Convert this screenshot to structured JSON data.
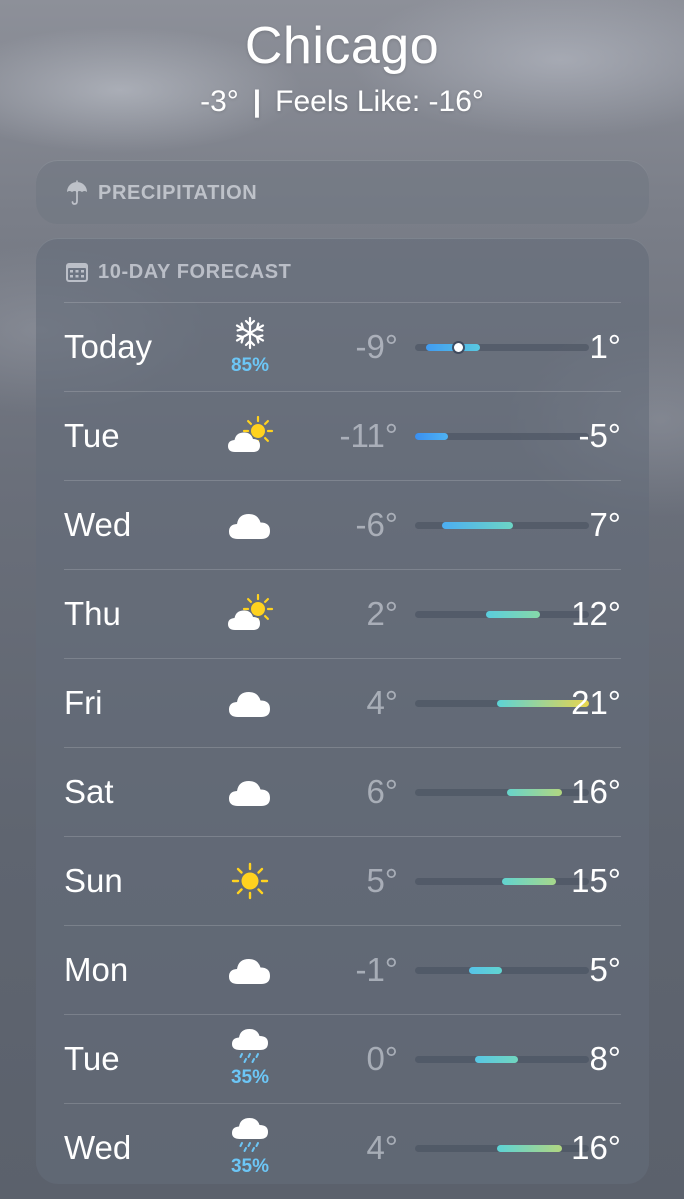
{
  "location": {
    "city": "Chicago",
    "current_temp": "-3°",
    "separator": "|",
    "feels_like": "Feels Like: -16°"
  },
  "precipitation": {
    "title": "PRECIPITATION",
    "icon": "umbrella-icon"
  },
  "forecast": {
    "title": "10-DAY FORECAST",
    "icon": "calendar-icon",
    "range_scale": {
      "min": -11,
      "max": 21
    },
    "current_temp_value": -3,
    "days": [
      {
        "day": "Today",
        "condition": "snow",
        "icon": "snowflake-icon",
        "chance": "85%",
        "low": "-9°",
        "high": "1°",
        "low_value": -9,
        "high_value": 1
      },
      {
        "day": "Tue",
        "condition": "partly-cloudy",
        "icon": "partly-sunny-icon",
        "chance": "",
        "low": "-11°",
        "high": "-5°",
        "low_value": -11,
        "high_value": -5
      },
      {
        "day": "Wed",
        "condition": "cloudy",
        "icon": "cloud-icon",
        "chance": "",
        "low": "-6°",
        "high": "7°",
        "low_value": -6,
        "high_value": 7
      },
      {
        "day": "Thu",
        "condition": "partly-cloudy",
        "icon": "partly-sunny-icon",
        "chance": "",
        "low": "2°",
        "high": "12°",
        "low_value": 2,
        "high_value": 12
      },
      {
        "day": "Fri",
        "condition": "cloudy",
        "icon": "cloud-icon",
        "chance": "",
        "low": "4°",
        "high": "21°",
        "low_value": 4,
        "high_value": 21
      },
      {
        "day": "Sat",
        "condition": "cloudy",
        "icon": "cloud-icon",
        "chance": "",
        "low": "6°",
        "high": "16°",
        "low_value": 6,
        "high_value": 16
      },
      {
        "day": "Sun",
        "condition": "sunny",
        "icon": "sun-icon",
        "chance": "",
        "low": "5°",
        "high": "15°",
        "low_value": 5,
        "high_value": 15
      },
      {
        "day": "Mon",
        "condition": "cloudy",
        "icon": "cloud-icon",
        "chance": "",
        "low": "-1°",
        "high": "5°",
        "low_value": -1,
        "high_value": 5
      },
      {
        "day": "Tue",
        "condition": "rain",
        "icon": "rain-cloud-icon",
        "chance": "35%",
        "low": "0°",
        "high": "8°",
        "low_value": 0,
        "high_value": 8
      },
      {
        "day": "Wed",
        "condition": "rain",
        "icon": "rain-cloud-icon",
        "chance": "35%",
        "low": "4°",
        "high": "16°",
        "low_value": 4,
        "high_value": 16
      }
    ]
  },
  "colors": {
    "cold": "#3a8ff0",
    "cool": "#53b9f2",
    "mild": "#5cd3d6",
    "warm": "#86d8a8",
    "hot": "#e8d44d",
    "precip_text": "#6cc6f6",
    "sun": "#ffd21f"
  }
}
